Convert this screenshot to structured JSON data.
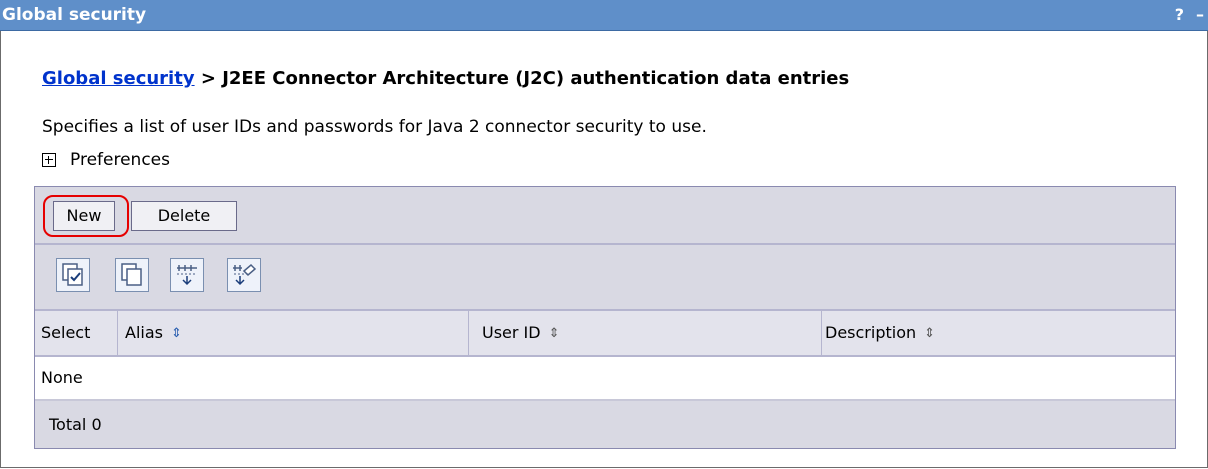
{
  "window": {
    "title": "Global security",
    "help_label": "?",
    "minimize_label": "–"
  },
  "breadcrumb": {
    "link": "Global security",
    "separator": " > ",
    "current": "J2EE Connector Architecture (J2C) authentication data entries"
  },
  "description": "Specifies a list of user IDs and passwords for Java 2 connector security to use.",
  "preferences": {
    "label": "Preferences",
    "icon": "plus-expand-icon"
  },
  "toolbar": {
    "new_label": "New",
    "delete_label": "Delete"
  },
  "tool_icons": [
    "select-all-icon",
    "deselect-all-icon",
    "show-filter-icon",
    "clear-filter-icon"
  ],
  "table": {
    "columns": {
      "select": "Select",
      "alias": "Alias",
      "user_id": "User ID",
      "description": "Description"
    },
    "empty_text": "None",
    "total_text": "Total 0"
  },
  "colors": {
    "titlebar": "#5f8fc9",
    "link": "#0033cc",
    "highlight": "#e60000",
    "toolbar_bg": "#d9d9e3"
  }
}
